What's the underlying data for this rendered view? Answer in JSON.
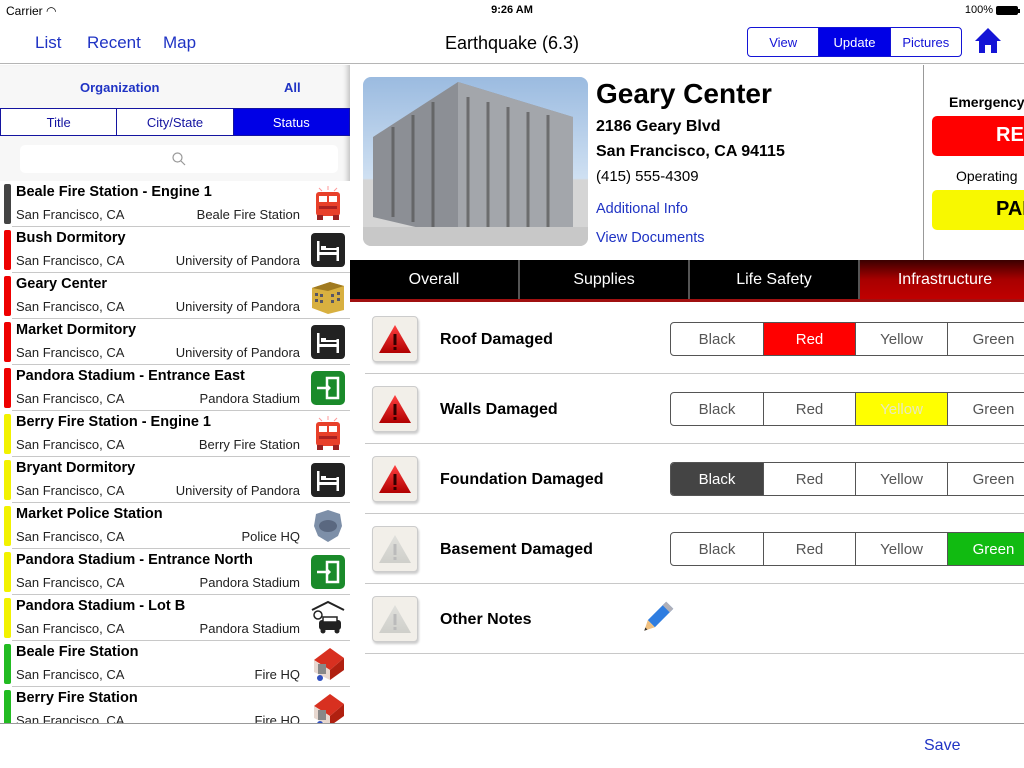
{
  "statusbar": {
    "carrier": "Carrier",
    "time": "9:26 AM",
    "battery": "100%"
  },
  "navbar": {
    "links": [
      "List",
      "Recent",
      "Map"
    ],
    "title": "Earthquake (6.3)",
    "mode_segments": [
      {
        "label": "View",
        "active": false
      },
      {
        "label": "Update",
        "active": true
      },
      {
        "label": "Pictures",
        "active": false
      }
    ],
    "home_icon": "home-icon"
  },
  "sidebar": {
    "filter_label": "Organization",
    "filter_value": "All",
    "sort_segments": [
      {
        "label": "Title",
        "active": false
      },
      {
        "label": "City/State",
        "active": false
      },
      {
        "label": "Status",
        "active": true
      }
    ],
    "search_placeholder": "",
    "items": [
      {
        "title": "Beale Fire Station - Engine 1",
        "city": "San Francisco, CA",
        "org": "Beale Fire Station",
        "status_color": "#444444",
        "icon": "fire-truck"
      },
      {
        "title": "Bush Dormitory",
        "city": "San Francisco, CA",
        "org": "University of Pandora",
        "status_color": "#ee0000",
        "icon": "bed"
      },
      {
        "title": "Geary Center",
        "city": "San Francisco, CA",
        "org": "University of Pandora",
        "status_color": "#ee0000",
        "icon": "building"
      },
      {
        "title": "Market Dormitory",
        "city": "San Francisco, CA",
        "org": "University of Pandora",
        "status_color": "#ee0000",
        "icon": "bed"
      },
      {
        "title": "Pandora Stadium - Entrance East",
        "city": "San Francisco, CA",
        "org": "Pandora Stadium",
        "status_color": "#ee0000",
        "icon": "entrance"
      },
      {
        "title": "Berry Fire Station - Engine 1",
        "city": "San Francisco, CA",
        "org": "Berry Fire Station",
        "status_color": "#f2f200",
        "icon": "fire-truck"
      },
      {
        "title": "Bryant Dormitory",
        "city": "San Francisco, CA",
        "org": "University of Pandora",
        "status_color": "#f2f200",
        "icon": "bed"
      },
      {
        "title": "Market Police Station",
        "city": "San Francisco, CA",
        "org": "Police HQ",
        "status_color": "#f2f200",
        "icon": "police-badge"
      },
      {
        "title": "Pandora Stadium - Entrance North",
        "city": "San Francisco, CA",
        "org": "Pandora Stadium",
        "status_color": "#f2f200",
        "icon": "entrance"
      },
      {
        "title": "Pandora Stadium - Lot B",
        "city": "San Francisco, CA",
        "org": "Pandora Stadium",
        "status_color": "#f2f200",
        "icon": "parking"
      },
      {
        "title": "Beale Fire Station",
        "city": "San Francisco, CA",
        "org": "Fire HQ",
        "status_color": "#22bb22",
        "icon": "fire-station"
      },
      {
        "title": "Berry Fire Station",
        "city": "San Francisco, CA",
        "org": "Fire HQ",
        "status_color": "#22bb22",
        "icon": "fire-station"
      }
    ]
  },
  "detail": {
    "name": "Geary Center",
    "address1": "2186 Geary Blvd",
    "address2": "San Francisco, CA 94115",
    "phone": "(415) 555-4309",
    "links": [
      "Additional Info",
      "View Documents"
    ],
    "status": [
      {
        "label": "Emergency",
        "value": "RED",
        "color": "#ff0000",
        "text_color": "#ffffff"
      },
      {
        "label": "Operating",
        "value": "PARTIAL",
        "color": "#f8f800",
        "text_color": "#000000"
      }
    ],
    "tabs": [
      {
        "label": "Overall",
        "active": false
      },
      {
        "label": "Supplies",
        "active": false
      },
      {
        "label": "Life Safety",
        "active": false
      },
      {
        "label": "Infrastructure",
        "active": true
      }
    ],
    "choice_labels": [
      "Black",
      "Red",
      "Yellow",
      "Green"
    ],
    "choice_colors": {
      "Black": "#444444",
      "Red": "#ff0000",
      "Yellow": "#ffff00",
      "Green": "#11bb11"
    },
    "rows": [
      {
        "label": "Roof Damaged",
        "selected": "Red",
        "warning": true
      },
      {
        "label": "Walls Damaged",
        "selected": "Yellow",
        "warning": true
      },
      {
        "label": "Foundation Damaged",
        "selected": "Black",
        "warning": true
      },
      {
        "label": "Basement Damaged",
        "selected": "Green",
        "warning": false
      },
      {
        "label": "Other Notes",
        "selected": null,
        "warning": false,
        "notes": true
      }
    ]
  },
  "footer": {
    "save_label": "Save"
  }
}
